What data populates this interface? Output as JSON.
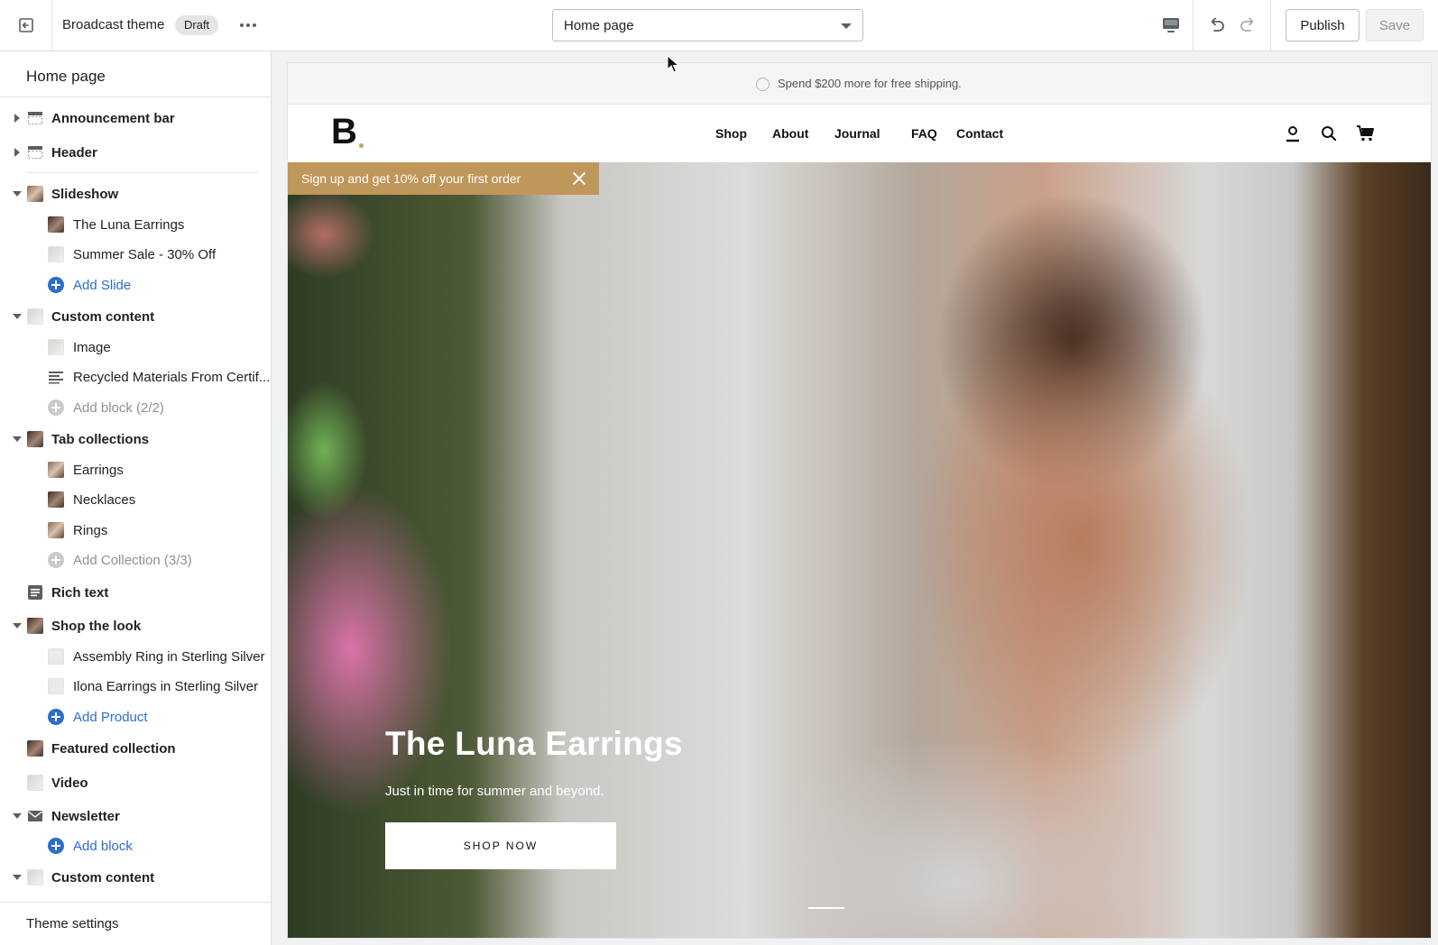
{
  "topbar": {
    "theme_name": "Broadcast theme",
    "status_badge": "Draft",
    "page_selector": "Home page",
    "publish_label": "Publish",
    "save_label": "Save",
    "icons": [
      "exit-icon",
      "more-horizontal-icon",
      "desktop-icon",
      "undo-icon",
      "redo-icon"
    ]
  },
  "sidebar": {
    "title": "Home page",
    "sections": [
      {
        "label": "Announcement bar",
        "state": "collapsed",
        "icon": "section-top-icon"
      },
      {
        "label": "Header",
        "state": "collapsed",
        "icon": "section-header-icon"
      },
      {
        "label": "Slideshow",
        "state": "expanded",
        "icon": "image-thumb",
        "children": [
          "The Luna Earrings",
          "Summer Sale - 30% Off"
        ],
        "add": "Add Slide"
      },
      {
        "label": "Custom content",
        "state": "expanded",
        "icon": "image-thumb",
        "children": [
          "Image",
          "Recycled Materials From Certif..."
        ],
        "add": "Add block (2/2)"
      },
      {
        "label": "Tab collections",
        "state": "expanded",
        "icon": "image-thumb",
        "children": [
          "Earrings",
          "Necklaces",
          "Rings"
        ],
        "add": "Add Collection (3/3)"
      },
      {
        "label": "Rich text",
        "icon": "text-icon"
      },
      {
        "label": "Shop the look",
        "state": "expanded",
        "icon": "image-thumb",
        "children": [
          "Assembly Ring in Sterling Silver",
          "Ilona Earrings in Sterling Silver"
        ],
        "add": "Add Product"
      },
      {
        "label": "Featured collection",
        "icon": "image-thumb"
      },
      {
        "label": "Video",
        "icon": "image-thumb"
      },
      {
        "label": "Newsletter",
        "state": "expanded",
        "icon": "mail-icon",
        "add": "Add block"
      },
      {
        "label": "Custom content",
        "state": "expanded",
        "icon": "image-thumb"
      }
    ],
    "footer": "Theme settings"
  },
  "preview": {
    "announcement": "Spend $200 more for free shipping.",
    "logo": "B",
    "nav": [
      "Shop",
      "About",
      "Journal",
      "FAQ",
      "Contact"
    ],
    "signup_bar": "Sign up and get 10% off your first order",
    "hero_title": "The Luna Earrings",
    "hero_subtitle": "Just in time for summer and beyond.",
    "hero_button": "SHOP NOW",
    "colors": {
      "signup_bar": "#c0975a",
      "link": "#2c6ecb"
    }
  }
}
